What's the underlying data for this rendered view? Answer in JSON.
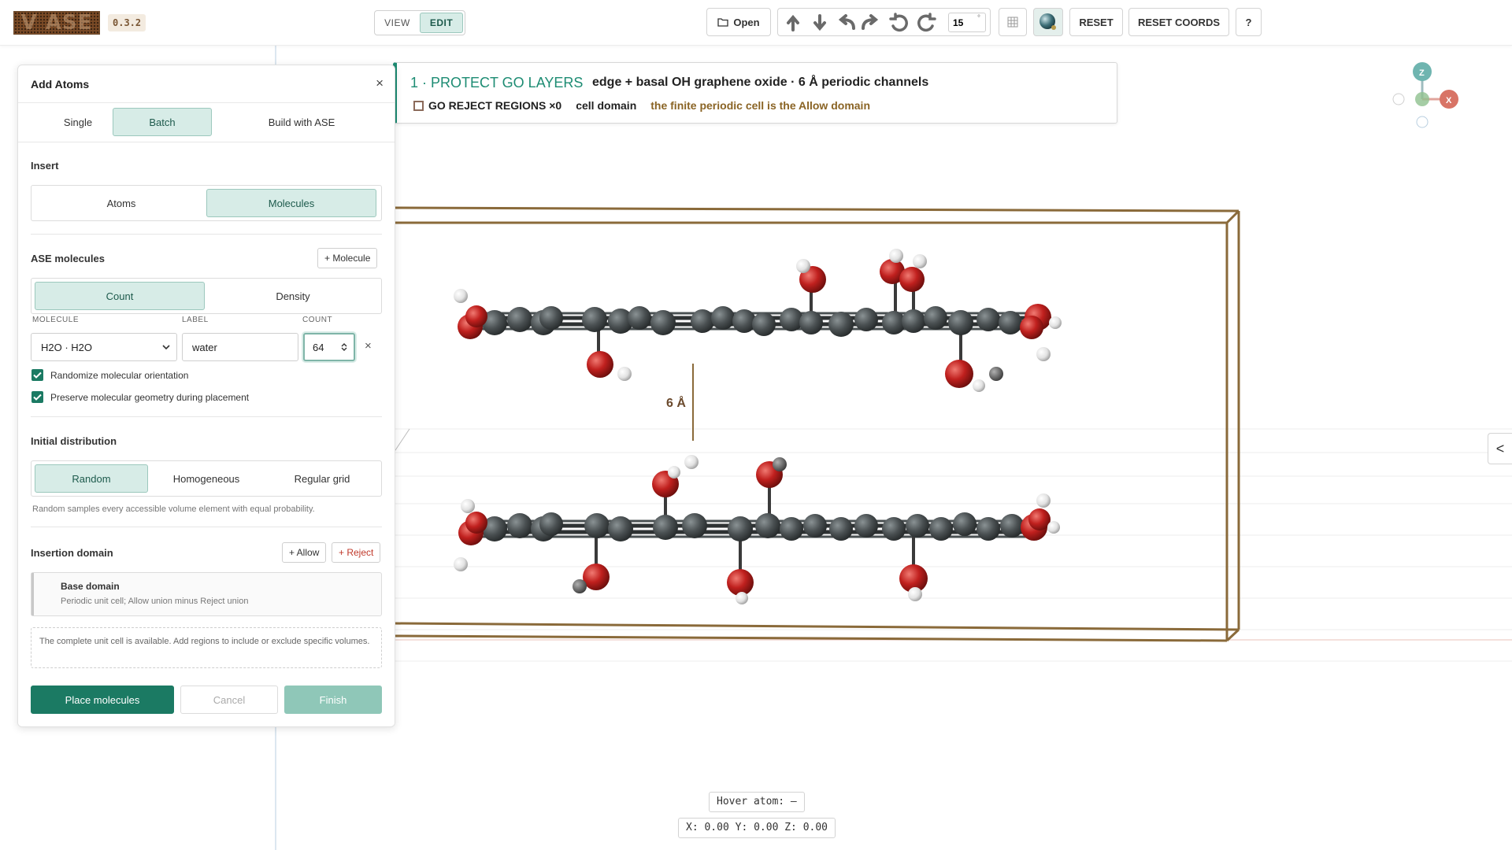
{
  "app": {
    "logo_text": "V ASE",
    "version": "0.3.2"
  },
  "toolbar": {
    "view_label": "VIEW",
    "edit_label": "EDIT",
    "active_mode": "EDIT",
    "open_label": "Open",
    "angle_value": "15",
    "angle_unit": "°",
    "reset_label": "RESET",
    "reset_coords_label": "RESET COORDS",
    "help_label": "?"
  },
  "panel": {
    "title": "Add Atoms",
    "close_label": "×",
    "tabs": [
      {
        "label": "Single",
        "active": false
      },
      {
        "label": "Batch",
        "active": true
      },
      {
        "label": "Build with ASE",
        "active": false
      }
    ],
    "insert": {
      "title": "Insert",
      "options": [
        {
          "label": "Atoms",
          "active": false
        },
        {
          "label": "Molecules",
          "active": true
        }
      ]
    },
    "ase_molecules": {
      "title": "ASE molecules",
      "add_label": "+ Molecule",
      "mode_options": [
        {
          "label": "Count",
          "active": true
        },
        {
          "label": "Density",
          "active": false
        }
      ],
      "columns": {
        "molecule": "MOLECULE",
        "label": "LABEL",
        "count": "COUNT"
      },
      "row": {
        "molecule": "H2O · H2O",
        "label": "water",
        "count": "64",
        "remove_label": "×"
      },
      "checks": [
        {
          "label": "Randomize molecular orientation",
          "checked": true
        },
        {
          "label": "Preserve molecular geometry during placement",
          "checked": true
        }
      ]
    },
    "distribution": {
      "title": "Initial distribution",
      "options": [
        {
          "label": "Random",
          "active": true
        },
        {
          "label": "Homogeneous",
          "active": false
        },
        {
          "label": "Regular grid",
          "active": false
        }
      ],
      "hint": "Random samples every accessible volume element with equal probability."
    },
    "domain": {
      "title": "Insertion domain",
      "allow_label": "+ Allow",
      "reject_label": "+ Reject",
      "base_title": "Base domain",
      "base_desc": "Periodic unit cell; Allow union minus Reject union",
      "note": "The complete unit cell is available. Add regions to include or exclude specific volumes."
    },
    "footer": {
      "place_label": "Place molecules",
      "cancel_label": "Cancel",
      "finish_label": "Finish"
    }
  },
  "banner": {
    "title": "1 · PROTECT GO LAYERS",
    "subtitle": "edge + basal OH graphene oxide · 6 Å periodic channels",
    "reject_text": "GO REJECT REGIONS ×0",
    "cell_domain": "cell domain",
    "allow_note": "the finite periodic cell is the Allow domain"
  },
  "scene": {
    "gap_label": "6 Å",
    "axis_labels": {
      "z": "Z",
      "x": "X"
    },
    "colors": {
      "carbon": "#4a5052",
      "oxygen": "#c0201e",
      "hydrogen": "#e8e8e8",
      "cell": "#8a6a3a",
      "accent": "#1d8c73"
    }
  },
  "status": {
    "hover_atom": "Hover atom: –",
    "coords": "X: 0.00 Y: 0.00 Z: 0.00"
  },
  "side_toggle": "<"
}
